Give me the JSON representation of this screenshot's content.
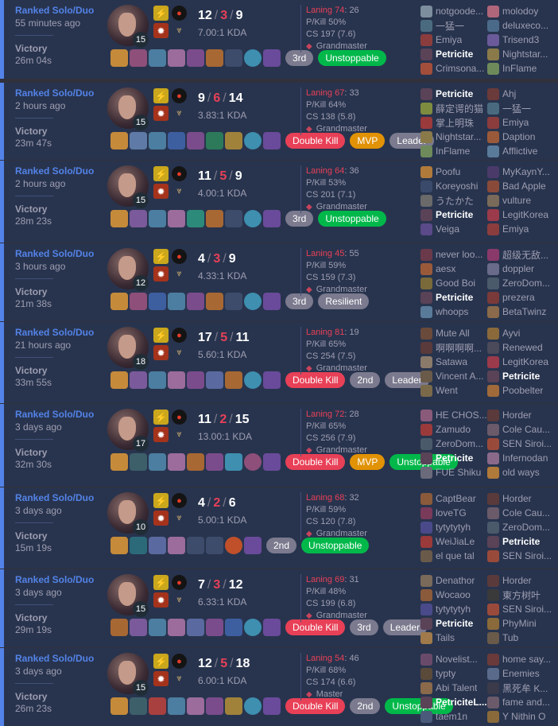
{
  "colors": {
    "accent": "#5383e8",
    "win": "#28344e",
    "death": "#e84057",
    "mvp": "#e19205",
    "unstoppable": "#00b84a",
    "neutral_badge": "#7b7a8e"
  },
  "icons": {
    "spell1": "flash-icon",
    "spell2": "ignite-icon",
    "rune_primary": "electrocute-icon",
    "rune_secondary": "domination-icon",
    "rank": "grandmaster-crest-icon"
  },
  "matches": [
    {
      "queue": "Ranked Solo/Duo",
      "ago": "55 minutes ago",
      "result": "Victory",
      "duration": "26m 04s",
      "level": "15",
      "kills": "12",
      "deaths": "3",
      "assists": "9",
      "kda": "7.00:1 KDA",
      "laning": "Laning 74",
      "laning_opp": ": 26",
      "pkill": "P/Kill 50%",
      "cs": "CS 197 (7.6)",
      "rank": "Grandmaster",
      "items": [
        "#c58a3a",
        "#8e4f7a",
        "#4b7ea0",
        "#9b6c9c",
        "#7a4c8c",
        "#a86833",
        "empty",
        "#3e8fb0",
        "#6a4a9a"
      ],
      "badges": [
        {
          "t": "3rd",
          "c": "gray"
        },
        {
          "t": "Unstoppable",
          "c": "green"
        }
      ],
      "team1": [
        {
          "n": "notgoode...",
          "c": "#7d8f9e"
        },
        {
          "n": "一猛一",
          "c": "#4a6b7f"
        },
        {
          "n": "Emiya",
          "c": "#8b3d3d"
        },
        {
          "n": "Petricite",
          "c": "#5a4257",
          "me": true
        },
        {
          "n": "Crimsona...",
          "c": "#a24e3b"
        }
      ],
      "team2": [
        {
          "n": "molodoy",
          "c": "#b0667a"
        },
        {
          "n": "deluxeco...",
          "c": "#4b6a8a"
        },
        {
          "n": "Trisend3",
          "c": "#6b5a9a"
        },
        {
          "n": "Nightstar...",
          "c": "#8a7a4a"
        },
        {
          "n": "InFlame",
          "c": "#6e8a5b"
        }
      ]
    },
    {
      "queue": "Ranked Solo/Duo",
      "ago": "2 hours ago",
      "result": "Victory",
      "duration": "23m 47s",
      "level": "15",
      "kills": "9",
      "deaths": "6",
      "assists": "14",
      "kda": "3.83:1 KDA",
      "laning": "Laning 67",
      "laning_opp": ": 33",
      "pkill": "P/Kill 64%",
      "cs": "CS 138 (5.8)",
      "rank": "Grandmaster",
      "items": [
        "#c58a3a",
        "#5f7aa6",
        "#4b7ea0",
        "#3d5fa0",
        "#7a4c8c",
        "#2c7a5a",
        "#a0823a",
        "#3e8fb0",
        "#6a4a9a"
      ],
      "badges": [
        {
          "t": "Double Kill",
          "c": "red"
        },
        {
          "t": "MVP",
          "c": "orange"
        },
        {
          "t": "Leader",
          "c": "gray"
        }
      ],
      "team1": [
        {
          "n": "Petricite",
          "c": "#5a4257",
          "me": true
        },
        {
          "n": "薛定谔的猫",
          "c": "#7e8c3f"
        },
        {
          "n": "掌上明珠",
          "c": "#9a3a3a"
        },
        {
          "n": "Nightstar...",
          "c": "#8a7a4a"
        },
        {
          "n": "InFlame",
          "c": "#6e8a5b"
        }
      ],
      "team2": [
        {
          "n": "Ahj",
          "c": "#6b3a3a"
        },
        {
          "n": "一猛一",
          "c": "#4a6b7f"
        },
        {
          "n": "Emiya",
          "c": "#8b3d3d"
        },
        {
          "n": "Daption",
          "c": "#9a5a3a"
        },
        {
          "n": "Afflictive",
          "c": "#5a7a9a"
        }
      ]
    },
    {
      "queue": "Ranked Solo/Duo",
      "ago": "2 hours ago",
      "result": "Victory",
      "duration": "28m 23s",
      "level": "15",
      "kills": "11",
      "deaths": "5",
      "assists": "9",
      "kda": "4.00:1 KDA",
      "laning": "Laning 64",
      "laning_opp": ": 36",
      "pkill": "P/Kill 53%",
      "cs": "CS 201 (7.1)",
      "rank": "Grandmaster",
      "items": [
        "#c58a3a",
        "#7a5a9a",
        "#4b7ea0",
        "#9b6c9c",
        "#2c8a7a",
        "#a86833",
        "empty",
        "#3e8fb0",
        "#6a4a9a"
      ],
      "badges": [
        {
          "t": "3rd",
          "c": "gray"
        },
        {
          "t": "Unstoppable",
          "c": "green"
        }
      ],
      "team1": [
        {
          "n": "Poofu",
          "c": "#b07a3a"
        },
        {
          "n": "Koreyoshi",
          "c": "#3a4a6a"
        },
        {
          "n": "うたかた",
          "c": "#6a6a6a"
        },
        {
          "n": "Petricite",
          "c": "#5a4257",
          "me": true
        },
        {
          "n": "Veiga",
          "c": "#5a4a8a"
        }
      ],
      "team2": [
        {
          "n": "MyKaynY...",
          "c": "#4a3a6a"
        },
        {
          "n": "Bad Apple",
          "c": "#8a4a3a"
        },
        {
          "n": "vulture",
          "c": "#7a6a5a"
        },
        {
          "n": "LegitKorea",
          "c": "#9a3a4a"
        },
        {
          "n": "Emiya",
          "c": "#8b3d3d"
        }
      ]
    },
    {
      "queue": "Ranked Solo/Duo",
      "ago": "3 hours ago",
      "result": "Victory",
      "duration": "21m 38s",
      "level": "12",
      "kills": "4",
      "deaths": "3",
      "assists": "9",
      "kda": "4.33:1 KDA",
      "laning": "Laning 45",
      "laning_opp": ": 55",
      "pkill": "P/Kill 59%",
      "cs": "CS 159 (7.3)",
      "rank": "Grandmaster",
      "items": [
        "#c58a3a",
        "#8e4f7a",
        "#3d5fa0",
        "#4b7ea0",
        "#7a4c8c",
        "#a86833",
        "empty",
        "#3e8fb0",
        "#6a4a9a"
      ],
      "badges": [
        {
          "t": "3rd",
          "c": "gray"
        },
        {
          "t": "Resilient",
          "c": "gray"
        }
      ],
      "team1": [
        {
          "n": "never loo...",
          "c": "#6a3a4a"
        },
        {
          "n": "aesx",
          "c": "#9a5a3a"
        },
        {
          "n": "Good Boi",
          "c": "#7a6a3a"
        },
        {
          "n": "Petricite",
          "c": "#5a4257",
          "me": true
        },
        {
          "n": "whoops",
          "c": "#5a7a9a"
        }
      ],
      "team2": [
        {
          "n": "超级无敌...",
          "c": "#8a3a6a"
        },
        {
          "n": "doppler",
          "c": "#6a6a8a"
        },
        {
          "n": "ZeroDom...",
          "c": "#4a5a6a"
        },
        {
          "n": "prezera",
          "c": "#7a3a3a"
        },
        {
          "n": "BetaTwinz",
          "c": "#8a6a4a"
        }
      ]
    },
    {
      "queue": "Ranked Solo/Duo",
      "ago": "21 hours ago",
      "result": "Victory",
      "duration": "33m 55s",
      "level": "18",
      "kills": "17",
      "deaths": "5",
      "assists": "11",
      "kda": "5.60:1 KDA",
      "laning": "Laning 81",
      "laning_opp": ": 19",
      "pkill": "P/Kill 65%",
      "cs": "CS 254 (7.5)",
      "rank": "Grandmaster",
      "items": [
        "#c58a3a",
        "#7a5a9a",
        "#4b7ea0",
        "#9b6c9c",
        "#7a4c8c",
        "#5a6aa0",
        "#a86833",
        "#3e8fb0",
        "#6a4a9a"
      ],
      "badges": [
        {
          "t": "Double Kill",
          "c": "red"
        },
        {
          "t": "2nd",
          "c": "gray"
        },
        {
          "t": "Leader",
          "c": "gray"
        }
      ],
      "team1": [
        {
          "n": "Mute All",
          "c": "#6a4a3a"
        },
        {
          "n": "啊啊啊啊...",
          "c": "#5a3a3a"
        },
        {
          "n": "Satawa",
          "c": "#8a7a6a"
        },
        {
          "n": "Vincent A...",
          "c": "#6a5a4a"
        },
        {
          "n": "Went",
          "c": "#7a6a4a"
        }
      ],
      "team2": [
        {
          "n": "Ayvi",
          "c": "#8a6a3a"
        },
        {
          "n": "Renewed",
          "c": "#4a4a5a"
        },
        {
          "n": "LegitKorea",
          "c": "#9a3a4a"
        },
        {
          "n": "Petricite",
          "c": "#5a4257",
          "me": true
        },
        {
          "n": "Poobelter",
          "c": "#a06a3a"
        }
      ]
    },
    {
      "queue": "Ranked Solo/Duo",
      "ago": "3 days ago",
      "result": "Victory",
      "duration": "32m 30s",
      "level": "17",
      "kills": "11",
      "deaths": "2",
      "assists": "15",
      "kda": "13.00:1 KDA",
      "laning": "Laning 72",
      "laning_opp": ": 28",
      "pkill": "P/Kill 65%",
      "cs": "CS 256 (7.9)",
      "rank": "Grandmaster",
      "items": [
        "#c58a3a",
        "#3d5f6a",
        "#4b7ea0",
        "#9b6c9c",
        "#a86833",
        "#7a4c8c",
        "#3e8fb0",
        "#8e4f7a",
        "#6a4a9a"
      ],
      "badges": [
        {
          "t": "Double Kill",
          "c": "red"
        },
        {
          "t": "MVP",
          "c": "orange"
        },
        {
          "t": "Unstoppable",
          "c": "green"
        }
      ],
      "team1": [
        {
          "n": "HE CHOS...",
          "c": "#8a5a7a"
        },
        {
          "n": "Zamudo",
          "c": "#9a3a3a"
        },
        {
          "n": "ZeroDom...",
          "c": "#4a5a6a"
        },
        {
          "n": "Petricite",
          "c": "#5a4257",
          "me": true
        },
        {
          "n": "FUE Shiku",
          "c": "#6a6a7a"
        }
      ],
      "team2": [
        {
          "n": "Horder",
          "c": "#5a3a3a"
        },
        {
          "n": "Cole Cau...",
          "c": "#6a5a6a"
        },
        {
          "n": "SEN Siroi...",
          "c": "#9a4a3a"
        },
        {
          "n": "Infernodan",
          "c": "#8a6a8a"
        },
        {
          "n": "old ways",
          "c": "#b07a3a"
        }
      ]
    },
    {
      "queue": "Ranked Solo/Duo",
      "ago": "3 days ago",
      "result": "Victory",
      "duration": "15m 19s",
      "level": "10",
      "kills": "4",
      "deaths": "2",
      "assists": "6",
      "kda": "5.00:1 KDA",
      "laning": "Laning 68",
      "laning_opp": ": 32",
      "pkill": "P/Kill 59%",
      "cs": "CS 120 (7.8)",
      "rank": "Grandmaster",
      "items": [
        "#c58a3a",
        "#2c6a7a",
        "#5a6aa0",
        "#9b6c9c",
        "empty",
        "empty",
        "#c0502a",
        "#6a4a9a"
      ],
      "badges": [
        {
          "t": "2nd",
          "c": "gray"
        },
        {
          "t": "Unstoppable",
          "c": "green"
        }
      ],
      "team1": [
        {
          "n": "CaptBear",
          "c": "#8a5a3a"
        },
        {
          "n": "loveTG",
          "c": "#7a3a5a"
        },
        {
          "n": "tytytytyh",
          "c": "#4a4a8a"
        },
        {
          "n": "WeiJiaLe",
          "c": "#9a3a3a"
        },
        {
          "n": "el que tal",
          "c": "#6a5a4a"
        }
      ],
      "team2": [
        {
          "n": "Horder",
          "c": "#5a3a3a"
        },
        {
          "n": "Cole Cau...",
          "c": "#6a5a6a"
        },
        {
          "n": "ZeroDom...",
          "c": "#4a5a6a"
        },
        {
          "n": "Petricite",
          "c": "#5a4257",
          "me": true
        },
        {
          "n": "SEN Siroi...",
          "c": "#9a4a3a"
        }
      ]
    },
    {
      "queue": "Ranked Solo/Duo",
      "ago": "3 days ago",
      "result": "Victory",
      "duration": "29m 19s",
      "level": "15",
      "kills": "7",
      "deaths": "3",
      "assists": "12",
      "kda": "6.33:1 KDA",
      "laning": "Laning 69",
      "laning_opp": ": 31",
      "pkill": "P/Kill 48%",
      "cs": "CS 199 (6.8)",
      "rank": "Grandmaster",
      "items": [
        "#a86833",
        "#7a5a9a",
        "#4b7ea0",
        "#9b6c9c",
        "#5a6aa0",
        "#7a4c8c",
        "#3d5fa0",
        "#3e8fb0",
        "#6a4a9a"
      ],
      "badges": [
        {
          "t": "Double Kill",
          "c": "red"
        },
        {
          "t": "3rd",
          "c": "gray"
        },
        {
          "t": "Leader",
          "c": "gray"
        }
      ],
      "team1": [
        {
          "n": "Denathor",
          "c": "#7a6a5a"
        },
        {
          "n": "Wocaoo",
          "c": "#8a5a3a"
        },
        {
          "n": "tytytytyh",
          "c": "#4a4a8a"
        },
        {
          "n": "Petricite",
          "c": "#5a4257",
          "me": true
        },
        {
          "n": "Tails",
          "c": "#a07a4a"
        }
      ],
      "team2": [
        {
          "n": "Horder",
          "c": "#5a3a3a"
        },
        {
          "n": "東方树叶",
          "c": "#3a3a3a"
        },
        {
          "n": "SEN Siroi...",
          "c": "#9a4a3a"
        },
        {
          "n": "PhyMini",
          "c": "#8a6a3a"
        },
        {
          "n": "Tub",
          "c": "#6a5a4a"
        }
      ]
    },
    {
      "queue": "Ranked Solo/Duo",
      "ago": "3 days ago",
      "result": "Victory",
      "duration": "26m 23s",
      "level": "15",
      "kills": "12",
      "deaths": "5",
      "assists": "18",
      "kda": "6.00:1 KDA",
      "laning": "Laning 54",
      "laning_opp": ": 46",
      "pkill": "P/Kill 68%",
      "cs": "CS 174 (6.6)",
      "rank": "Master",
      "items": [
        "#c58a3a",
        "#3d5f6a",
        "#a84040",
        "#4b7ea0",
        "#9b6c9c",
        "#7a4c8c",
        "#a0823a",
        "#3e8fb0",
        "#6a4a9a"
      ],
      "badges": [
        {
          "t": "Double Kill",
          "c": "red"
        },
        {
          "t": "2nd",
          "c": "gray"
        },
        {
          "t": "Unstoppable",
          "c": "green"
        }
      ],
      "team1": [
        {
          "n": "Novelist...",
          "c": "#6a4a6a"
        },
        {
          "n": "typty",
          "c": "#5a4a3a"
        },
        {
          "n": "Abi Talent",
          "c": "#8a6a4a"
        },
        {
          "n": "PetriciteL...",
          "c": "#5a4257",
          "me": true
        },
        {
          "n": "taem1n",
          "c": "#4a5a7a"
        }
      ],
      "team2": [
        {
          "n": "home say...",
          "c": "#6a3a3a"
        },
        {
          "n": "Enemies",
          "c": "#5a6a8a"
        },
        {
          "n": "黑死牟 K...",
          "c": "#3a3a4a"
        },
        {
          "n": "fame and...",
          "c": "#6a5a6a"
        },
        {
          "n": "Y Nithin O",
          "c": "#8a6a3a"
        }
      ]
    }
  ]
}
